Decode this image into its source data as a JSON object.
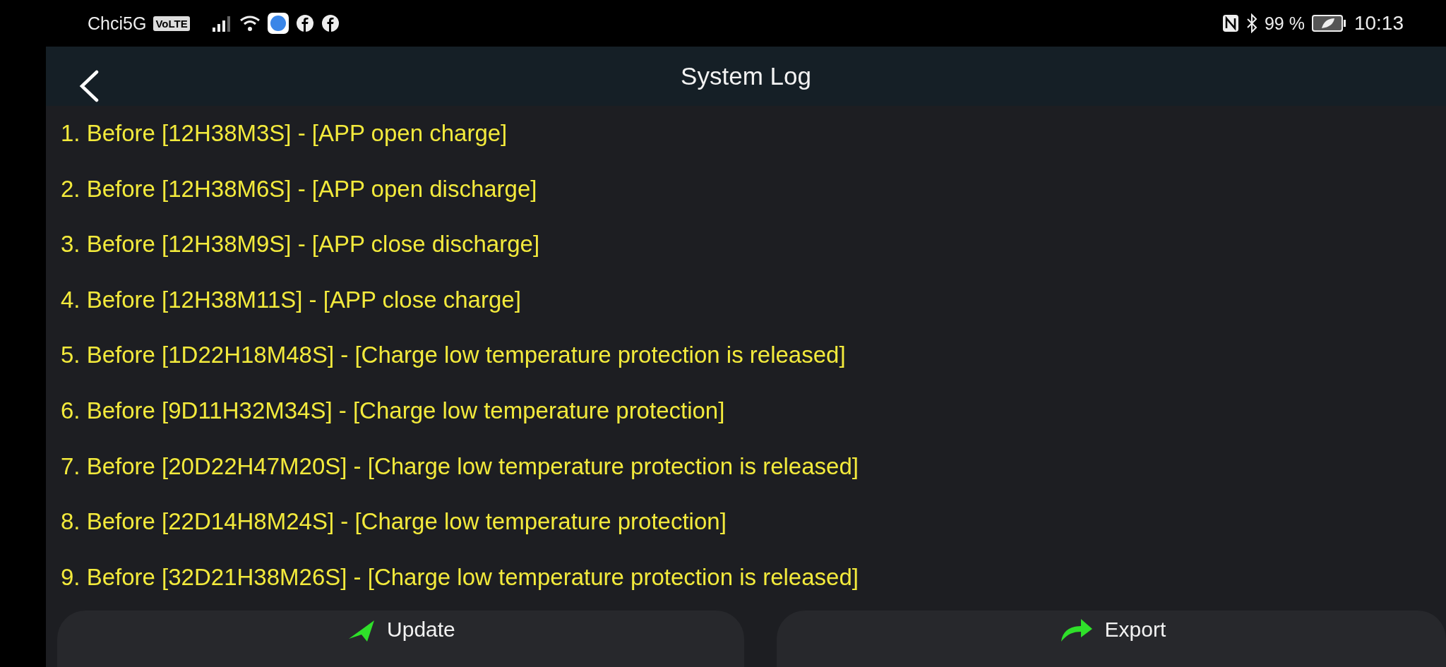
{
  "status_bar": {
    "carrier": "Chci5G",
    "network_badge": "VoLTE",
    "battery": "99 %",
    "time": "10:13"
  },
  "header": {
    "title": "System Log"
  },
  "log_entries": [
    "1. Before [12H38M3S] - [APP open charge]",
    "2. Before [12H38M6S] - [APP open discharge]",
    "3. Before [12H38M9S] - [APP close discharge]",
    "4. Before [12H38M11S] - [APP close charge]",
    "5. Before [1D22H18M48S] - [Charge low temperature protection is released]",
    "6. Before [9D11H32M34S] - [Charge low temperature protection]",
    "7. Before [20D22H47M20S] - [Charge low temperature protection is released]",
    "8. Before [22D14H8M24S] - [Charge low temperature protection]",
    "9. Before [32D21H38M26S] - [Charge low temperature protection is released]"
  ],
  "buttons": [
    {
      "kind": "update",
      "label": "Update"
    },
    {
      "kind": "export",
      "label": "Export"
    }
  ]
}
